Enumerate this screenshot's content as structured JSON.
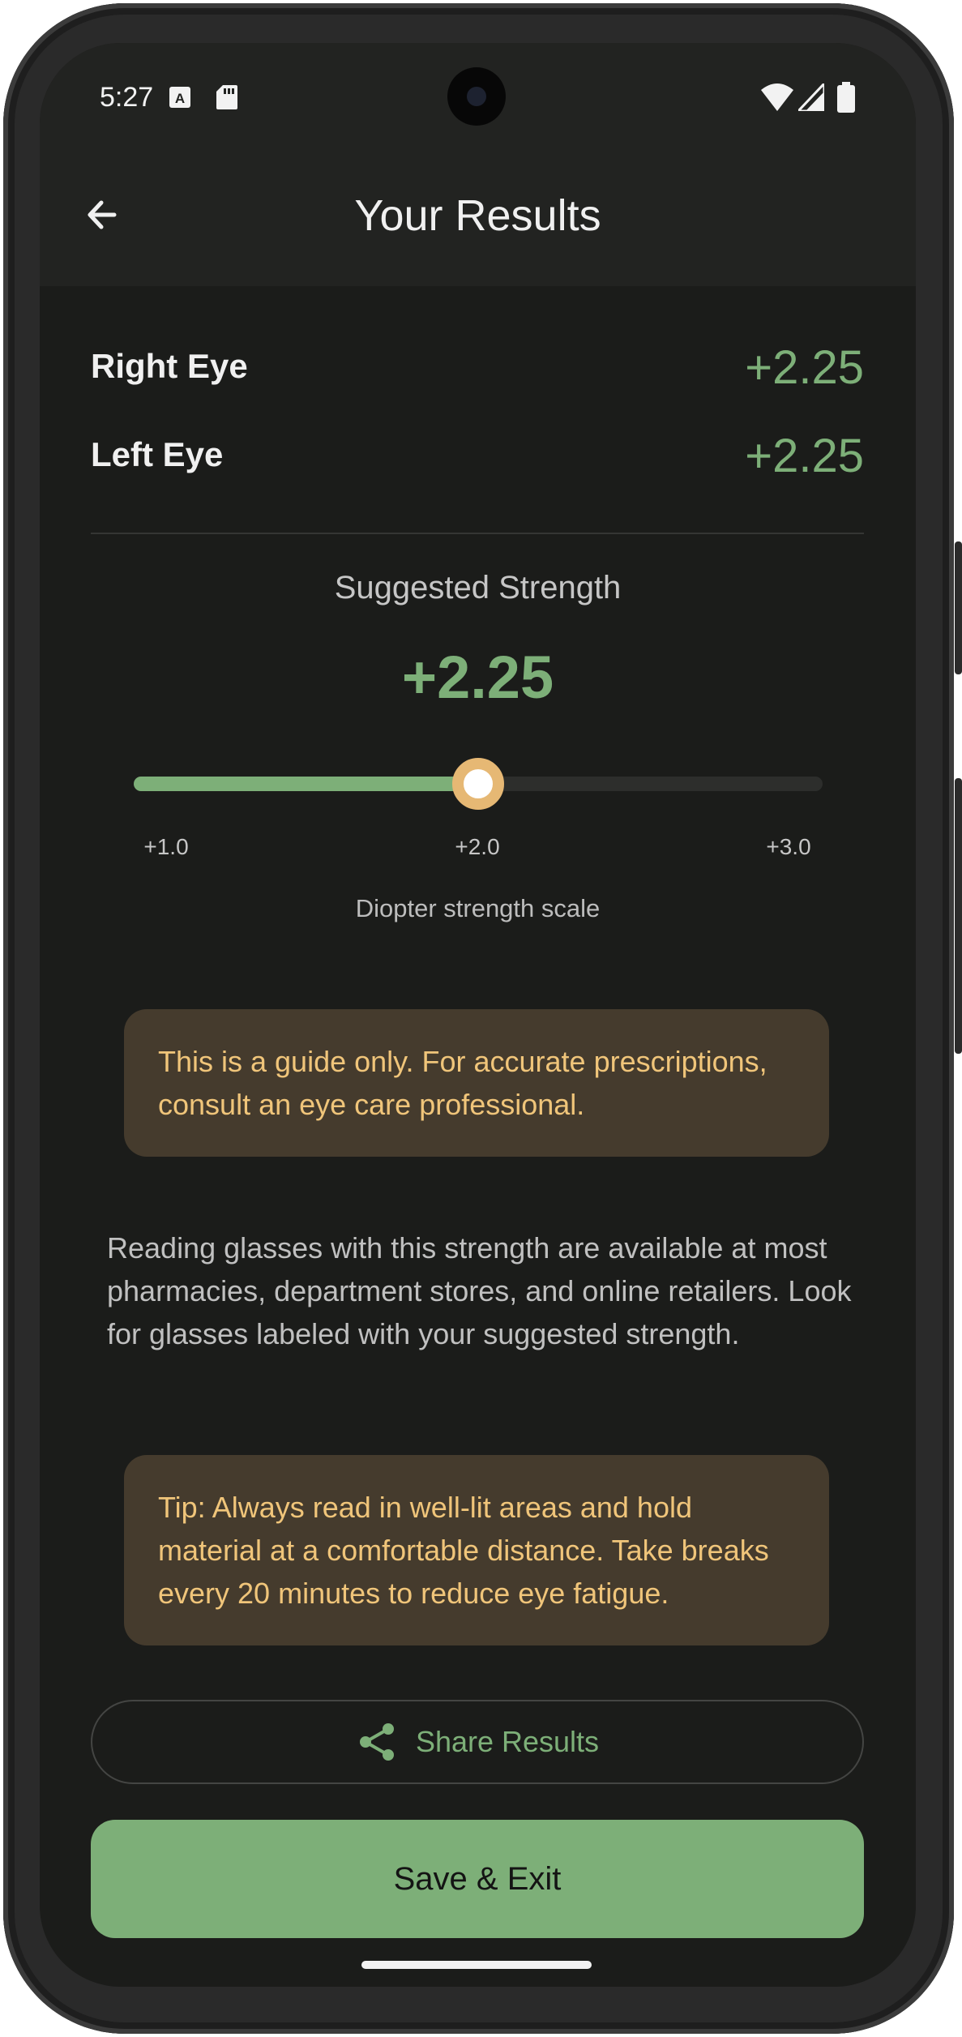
{
  "status_bar": {
    "time": "5:27",
    "icons": [
      "a-keyboard-icon",
      "sd-card-icon",
      "wifi-icon",
      "signal-icon",
      "battery-icon"
    ]
  },
  "app_bar": {
    "title": "Your Results",
    "back_icon": "arrow-left-icon"
  },
  "results": {
    "right_eye_label": "Right Eye",
    "right_eye_value": "+2.25",
    "left_eye_label": "Left Eye",
    "left_eye_value": "+2.25"
  },
  "suggested": {
    "label": "Suggested Strength",
    "value": "+2.25",
    "slider": {
      "min": 1.0,
      "max": 3.0,
      "value": 2.25
    },
    "ticks": [
      "+1.0",
      "+2.0",
      "+3.0"
    ],
    "caption": "Diopter strength scale"
  },
  "disclaimer": "This is a guide only. For accurate prescriptions, consult an eye care professional.",
  "info_paragraph": "Reading glasses with this strength are available at most pharmacies, department stores, and online retailers. Look for glasses labeled with your suggested strength.",
  "tip": "Tip: Always read in well-lit areas and hold material at a comfortable distance. Take breaks every 20 minutes to reduce eye fatigue.",
  "actions": {
    "share_label": "Share Results",
    "share_icon": "share-icon",
    "save_label": "Save & Exit"
  },
  "colors": {
    "accent_green": "#7daf78",
    "thumb_ring": "#e6b874",
    "notice_bg": "#453b2d",
    "notice_text": "#f0c57a",
    "background": "#1b1c1a"
  }
}
